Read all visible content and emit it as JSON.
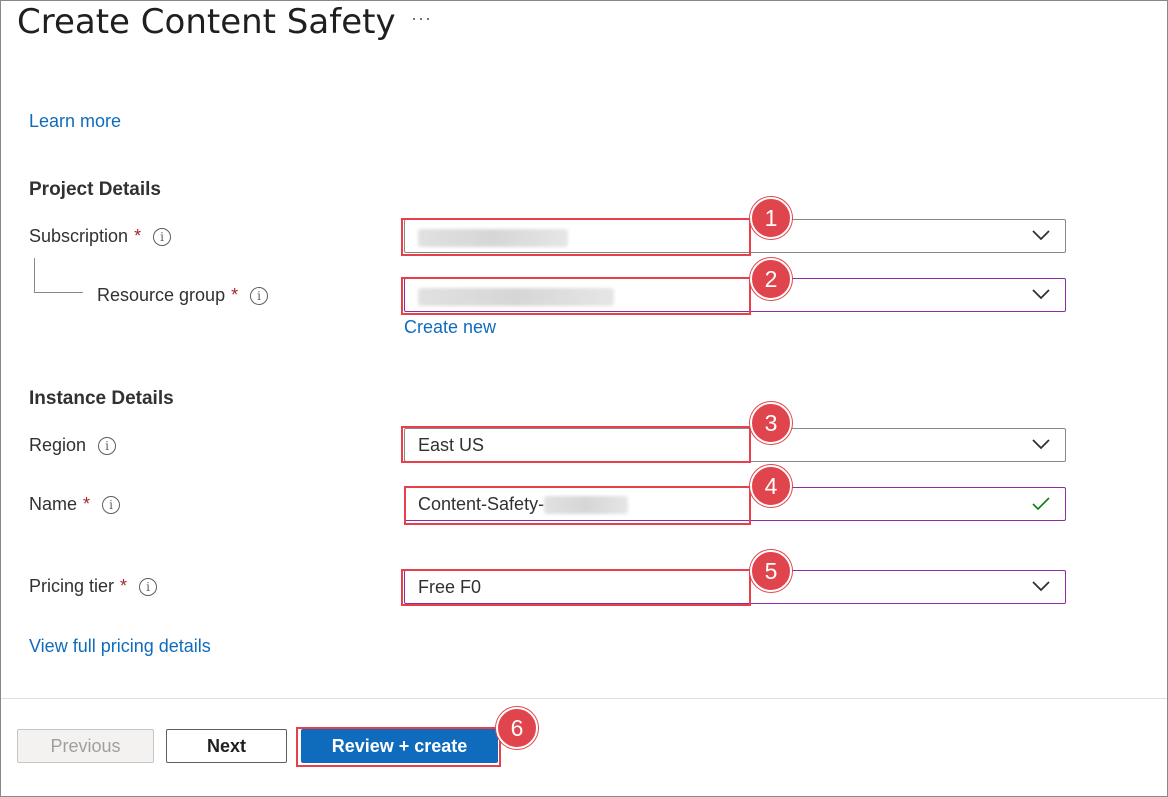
{
  "header": {
    "title": "Create Content Safety",
    "more": "···"
  },
  "learn_more": "Learn more",
  "project": {
    "heading": "Project Details",
    "subscription": {
      "label": "Subscription",
      "required": "*",
      "info": "i"
    },
    "resource_group": {
      "label": "Resource group",
      "required": "*",
      "info": "i"
    },
    "create_new": "Create new"
  },
  "instance": {
    "heading": "Instance Details",
    "region": {
      "label": "Region",
      "info": "i",
      "value": "East US"
    },
    "name": {
      "label": "Name",
      "required": "*",
      "info": "i",
      "value": "Content-Safety-"
    },
    "pricing": {
      "label": "Pricing tier",
      "required": "*",
      "info": "i",
      "value": "Free F0"
    }
  },
  "pricing_link": "View full pricing details",
  "footer": {
    "previous": "Previous",
    "next": "Next",
    "review_create": "Review + create"
  },
  "badges": [
    "1",
    "2",
    "3",
    "4",
    "5",
    "6"
  ],
  "colors": {
    "link": "#0f6cbd",
    "primary": "#0f6cbd",
    "highlight": "#e8404a",
    "valid": "#107c10"
  }
}
